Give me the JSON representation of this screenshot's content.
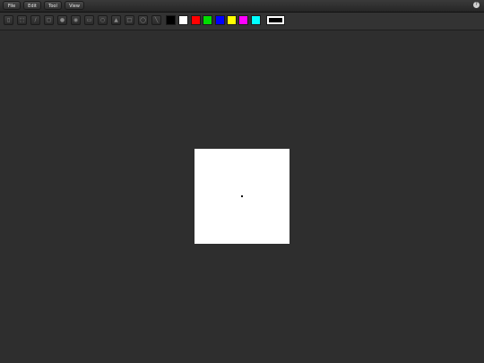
{
  "menubar": {
    "items": [
      {
        "label": "File"
      },
      {
        "label": "Edit"
      },
      {
        "label": "Tool"
      },
      {
        "label": "View"
      }
    ]
  },
  "toolbar": {
    "tools": [
      {
        "icon": "pointer-icon",
        "glyph": "▯"
      },
      {
        "icon": "lasso-icon",
        "glyph": "⬚"
      },
      {
        "icon": "pencil-icon",
        "glyph": "∕"
      },
      {
        "icon": "eraser-icon",
        "glyph": "▢"
      },
      {
        "icon": "brush-icon",
        "glyph": "●"
      },
      {
        "icon": "fill-icon",
        "glyph": "◉"
      },
      {
        "icon": "rectangle-icon",
        "glyph": "▭"
      },
      {
        "icon": "ellipse-icon",
        "glyph": "○"
      },
      {
        "icon": "triangle-icon",
        "glyph": "▲"
      },
      {
        "icon": "rounded-rect-icon",
        "glyph": "□"
      },
      {
        "icon": "circle-icon",
        "glyph": "◯"
      },
      {
        "icon": "line-icon",
        "glyph": "╲"
      }
    ],
    "palette": [
      {
        "name": "black",
        "color": "#000000"
      },
      {
        "name": "white",
        "color": "#ffffff"
      },
      {
        "name": "red",
        "color": "#ff0000"
      },
      {
        "name": "green",
        "color": "#00dd00"
      },
      {
        "name": "blue",
        "color": "#0000ff"
      },
      {
        "name": "yellow",
        "color": "#ffff00"
      },
      {
        "name": "magenta",
        "color": "#ff00ff"
      },
      {
        "name": "cyan",
        "color": "#00ffff"
      }
    ],
    "current_color": "#000000"
  },
  "colors": {
    "background": "#2e2e2e",
    "canvas": "#ffffff"
  }
}
